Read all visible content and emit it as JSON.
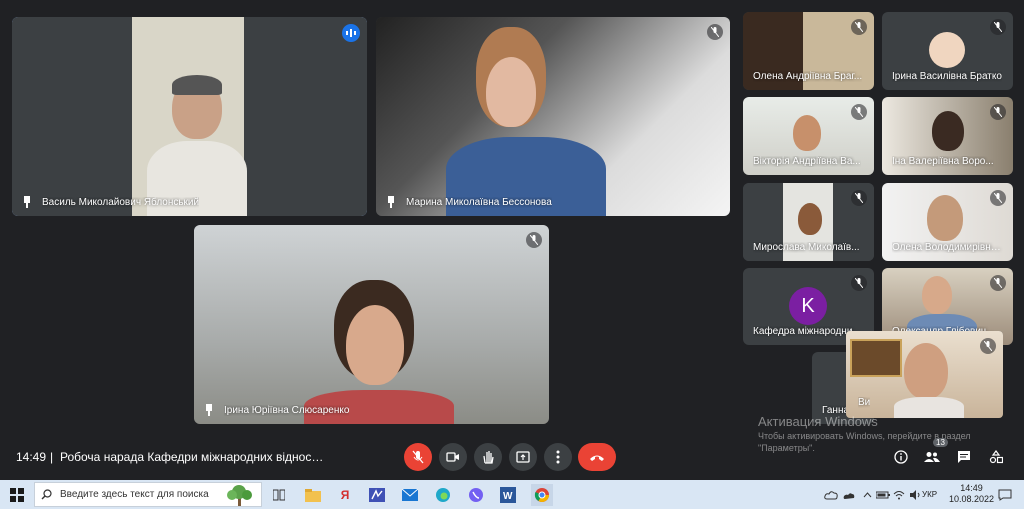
{
  "tiles": {
    "t1": {
      "name": "Василь Миколайович Яблонський"
    },
    "t2": {
      "name": "Марина Миколаївна Бессонова"
    },
    "t3": {
      "name": "Ірина Юріївна Слюсаренко"
    },
    "s1": {
      "name": "Олена Андріївна Браг..."
    },
    "s2": {
      "name": "Ірина Василівна Братко"
    },
    "s3": {
      "name": "Вікторія Андріївна Ва..."
    },
    "s4": {
      "name": "Іна Валеріївна Воро..."
    },
    "s5": {
      "name": "Мирослава Миколаїв..."
    },
    "s6": {
      "name": "Олена Володимирівна..."
    },
    "s7": {
      "name": "Кафедра міжнародни...",
      "initial": "K"
    },
    "s8": {
      "name": "Олександр Глібович..."
    },
    "s9": {
      "name": "Ганна..."
    },
    "self": {
      "name": "Ви"
    }
  },
  "bottom": {
    "time": "14:49",
    "separator": "|",
    "meeting_title": "Робоча нарада Кафедри міжнародних відносин т...",
    "participants_count": "13"
  },
  "watermark": {
    "line1": "Активация Windows",
    "line2": "Чтобы активировать Windows, перейдите в раздел",
    "line3": "\"Параметры\"."
  },
  "taskbar": {
    "search_placeholder": "Введите здесь текст для поиска",
    "lang": "УКР",
    "clock_time": "14:49",
    "clock_date": "10.08.2022"
  },
  "colors": {
    "accent": "#8ab4f8",
    "danger": "#ea4335",
    "bg": "#202124"
  }
}
